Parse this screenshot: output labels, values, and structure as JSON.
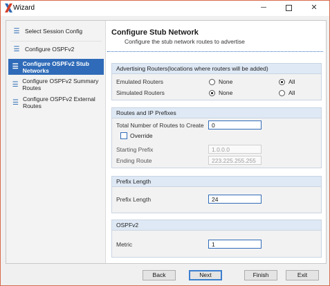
{
  "window": {
    "title": "Wizard",
    "minimize_glyph": "─",
    "close_glyph": "✕"
  },
  "sidebar": {
    "items": [
      {
        "label": "Select Session Config",
        "icon": "hamburger-icon",
        "glyph": "☰"
      },
      {
        "label": "Configure OSPFv2",
        "icon": "hamburger-icon",
        "glyph": "☰"
      },
      {
        "label": "Configure OSPFv2 Stub Networks",
        "icon": "hamburger-icon",
        "glyph": "☰",
        "active": true
      },
      {
        "label": "Configure OSPFv2 Summary Routes",
        "icon": "hamburger-icon",
        "glyph": "☰"
      },
      {
        "label": "Configure OSPFv2 External Routes",
        "icon": "hamburger-icon",
        "glyph": "☰"
      }
    ]
  },
  "main": {
    "title": "Configure Stub Network",
    "subtitle": "Configure the stub network routes to advertise"
  },
  "advertising": {
    "heading": "Advertising Routers(locations where routers will be added)",
    "emulated_label": "Emulated Routers",
    "simulated_label": "Simulated Routers",
    "opt_none": "None",
    "opt_all": "All",
    "emulated_selected": "All",
    "simulated_selected": "None"
  },
  "routes": {
    "heading": "Routes and IP Prefixes",
    "total_label": "Total Number of Routes to Create",
    "total_value": "0",
    "override_label": "Override",
    "override_checked": false,
    "starting_prefix_label": "Starting Prefix",
    "starting_prefix_value": "1.0.0.0",
    "ending_route_label": "Ending Route",
    "ending_route_value": "223.225.255.255"
  },
  "prefix": {
    "heading": "Prefix Length",
    "label": "Prefix Length",
    "value": "24"
  },
  "ospf": {
    "heading": "OSPFv2",
    "metric_label": "Metric",
    "metric_value": "1"
  },
  "buttons": {
    "back": "Back",
    "next": "Next",
    "finish": "Finish",
    "exit": "Exit"
  },
  "colors": {
    "accent": "#2f6bb8",
    "window_border": "#d66a4a",
    "group_header": "#dfe9f5"
  }
}
